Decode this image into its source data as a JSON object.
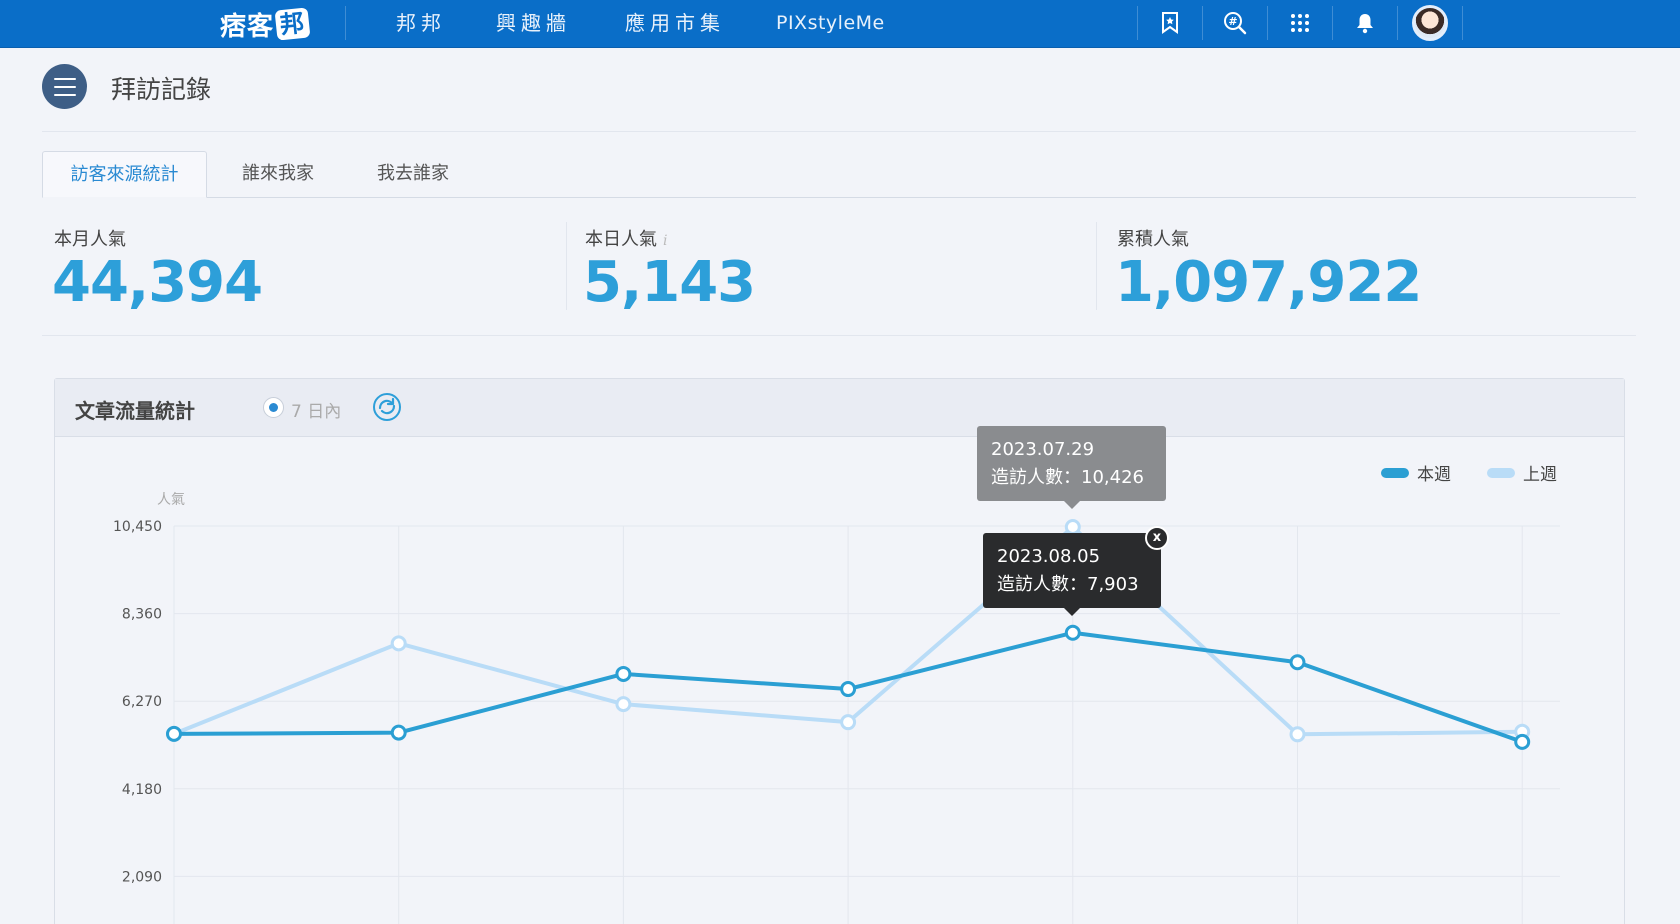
{
  "topbar": {
    "logo_text": "痞客",
    "logo_badge": "邦",
    "nav": [
      "邦邦",
      "興趣牆",
      "應用市集",
      "PIXstyleMe"
    ],
    "icons": [
      "bookmark-icon",
      "search-hashtag-icon",
      "apps-grid-icon",
      "bell-icon"
    ]
  },
  "page": {
    "title": "拜訪記錄"
  },
  "tabs": [
    {
      "label": "訪客來源統計",
      "active": true
    },
    {
      "label": "誰來我家",
      "active": false
    },
    {
      "label": "我去誰家",
      "active": false
    }
  ],
  "stats": {
    "month_label": "本月人氣",
    "month_value": "44,394",
    "today_label": "本日人氣",
    "today_info": "i",
    "today_value": "5,143",
    "total_label": "累積人氣",
    "total_value": "1,097,922"
  },
  "panel": {
    "title": "文章流量統計",
    "range_label": "7 日內"
  },
  "colors": {
    "this_week": "#2b9fd3",
    "last_week": "#b9dcf7",
    "accent": "#2d9fd9",
    "topbar": "#0a6ec8"
  },
  "chart_data": {
    "type": "line",
    "ylabel": "人氣",
    "ylim": [
      0,
      10450
    ],
    "yticks": [
      "10,450",
      "8,360",
      "6,270",
      "4,180",
      "2,090"
    ],
    "ytick_values": [
      10450,
      8360,
      6270,
      4180,
      2090
    ],
    "legend_position": "top-right",
    "series": [
      {
        "name": "本週",
        "values": [
          5490,
          5520,
          6920,
          6560,
          7903,
          7200,
          5300
        ]
      },
      {
        "name": "上週",
        "values": [
          5490,
          7650,
          6200,
          5770,
          10426,
          5480,
          5540
        ]
      }
    ],
    "tooltips": [
      {
        "date": "2023.07.29",
        "text": "造訪人數：10,426"
      },
      {
        "date": "2023.08.05",
        "text": "造訪人數：7,903"
      }
    ],
    "tooltip_close": "x"
  }
}
